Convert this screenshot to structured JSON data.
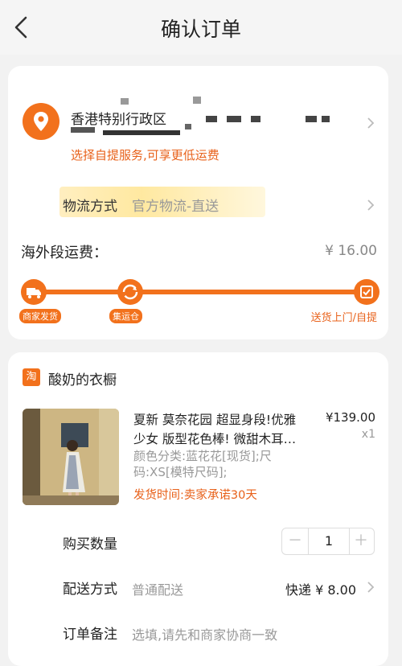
{
  "nav": {
    "title": "确认订单"
  },
  "address": {
    "region": "香港特别行政区",
    "self_pickup_tip": "选择自提服务,可享更低运费"
  },
  "logistics": {
    "label": "物流方式",
    "value": "官方物流-直送"
  },
  "overseas_fee": {
    "label": "海外段运费：",
    "value": "¥ 16.00"
  },
  "progress": {
    "stages": [
      "商家发货",
      "集运仓",
      "送货上门/自提"
    ]
  },
  "shop": {
    "icon_text": "淘",
    "name": "酸奶的衣橱"
  },
  "product": {
    "title_line1": "夏新 莫奈花园 超显身段!优雅",
    "title_line2": "少女 版型花色棒! 微甜木耳…",
    "price": "¥139.00",
    "quantity_label": "x1",
    "sku_line1": "颜色分类:蓝花花[现货];尺",
    "sku_line2": "码:XS[模特尺码];",
    "ship_time": "发货时间:卖家承诺30天"
  },
  "purchase": {
    "label": "购买数量",
    "minus": "－",
    "value": "1",
    "plus": "＋"
  },
  "delivery": {
    "label": "配送方式",
    "value": "普通配送",
    "right": "快递 ¥ 8.00"
  },
  "note": {
    "label": "订单备注",
    "placeholder": "选填,请先和商家协商一致"
  },
  "colors": {
    "accent": "#f2711c",
    "tip": "#e8611a",
    "bg": "#f2f2f2"
  }
}
